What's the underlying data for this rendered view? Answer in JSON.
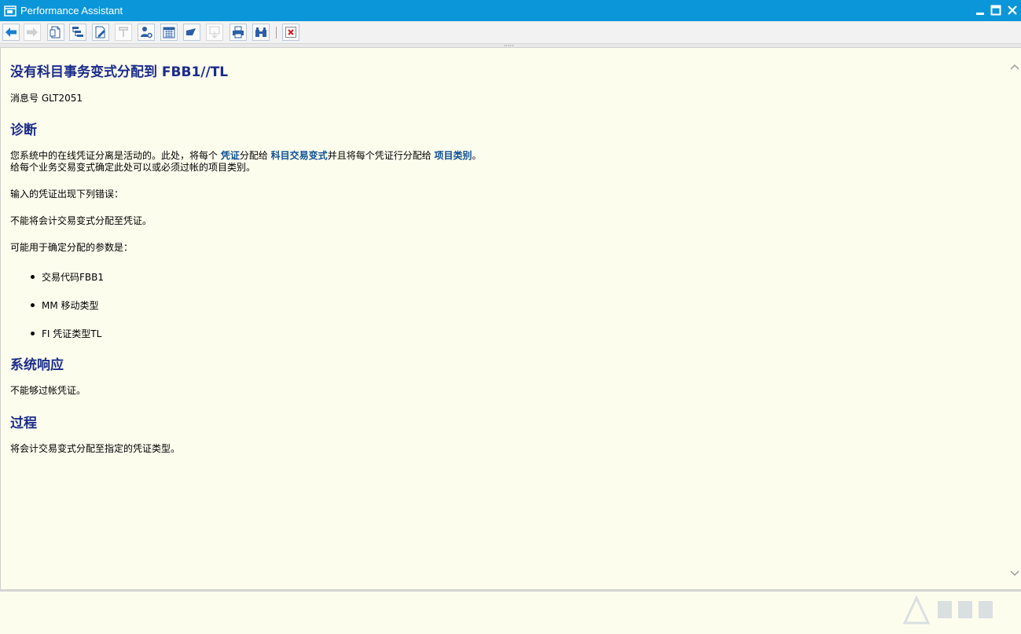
{
  "window": {
    "title": "Performance Assistant",
    "controls": [
      "minimize-icon",
      "maximize-icon",
      "close-icon"
    ]
  },
  "toolbar": {
    "buttons": [
      {
        "name": "back-icon",
        "enabled": true
      },
      {
        "name": "forward-icon",
        "enabled": false
      },
      {
        "name": "technical-info-icon",
        "enabled": true
      },
      {
        "name": "navigation-icon",
        "enabled": true
      },
      {
        "name": "edit-document-icon",
        "enabled": true
      },
      {
        "name": "highlight-icon",
        "enabled": false
      },
      {
        "name": "user-settings-icon",
        "enabled": true
      },
      {
        "name": "calendar-icon",
        "enabled": true
      },
      {
        "name": "bookmark-icon",
        "enabled": true
      },
      {
        "name": "export-icon",
        "enabled": false
      },
      {
        "name": "print-icon",
        "enabled": true
      },
      {
        "name": "binoculars-icon",
        "enabled": true
      },
      {
        "name": "close-red-icon",
        "enabled": true
      }
    ],
    "accent_color": "#0c96da"
  },
  "doc": {
    "title": "没有科目事务变式分配到  FBB1//TL",
    "message_no": "消息号  GLT2051",
    "diagnosis_heading": "诊断",
    "diag_line1": {
      "p1": "您系统中的在线凭证分离是活动的。此处，将每个 ",
      "link1": "凭证",
      "p2": "分配给 ",
      "link2": "科目交易变式",
      "p3": "并且将每个凭证行分配给 ",
      "link3": "项目类别",
      "p4": "。"
    },
    "diag_line2": "给每个业务交易变式确定此处可以或必须过帐的项目类别。",
    "error_intro": "输入的凭证出现下列错误：",
    "error_text": "不能将会计交易变式分配至凭证。",
    "params_intro": "可能用于确定分配的参数是：",
    "params": [
      "交易代码FBB1",
      "MM 移动类型",
      "FI 凭证类型TL"
    ],
    "system_response_heading": "系统响应",
    "system_response_text": "不能够过帐凭证。",
    "procedure_heading": "过程",
    "procedure_text": "将会计交易变式分配至指定的凭证类型。"
  },
  "colors": {
    "heading": "#1b2c8a",
    "link": "#0d4f93",
    "background": "#fdfdee"
  }
}
